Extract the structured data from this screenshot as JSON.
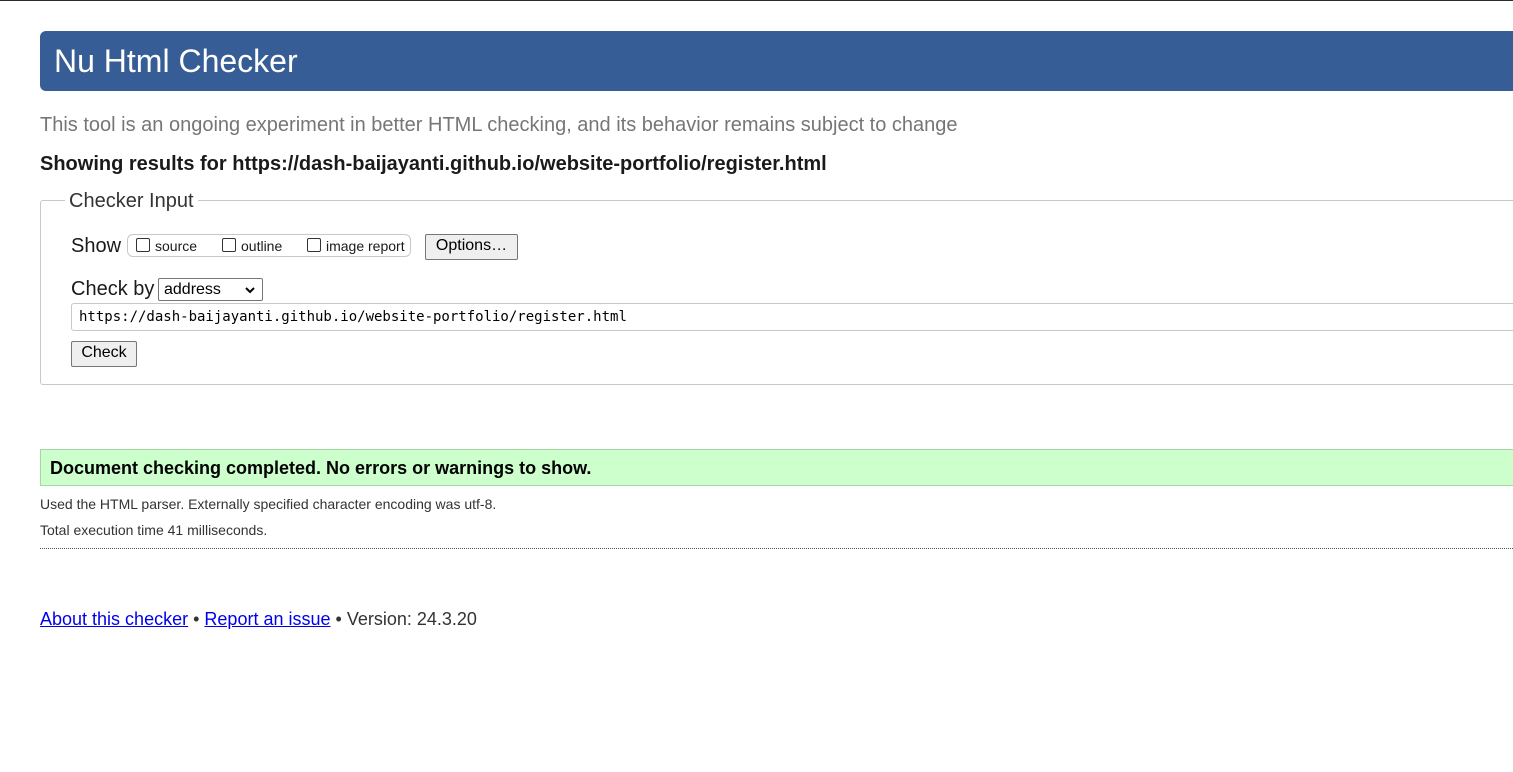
{
  "header": {
    "title": "Nu Html Checker"
  },
  "intro": "This tool is an ongoing experiment in better HTML checking, and its behavior remains subject to change",
  "results_for": "Showing results for https://dash-baijayanti.github.io/website-portfolio/register.html",
  "checker_input": {
    "legend": "Checker Input",
    "show_label": "Show",
    "show_options": [
      {
        "label": "source",
        "checked": false
      },
      {
        "label": "outline",
        "checked": false
      },
      {
        "label": "image report",
        "checked": false
      }
    ],
    "options_button": "Options…",
    "check_by_label": "Check by",
    "check_by_selected": "address",
    "url_value": "https://dash-baijayanti.github.io/website-portfolio/register.html",
    "check_button": "Check"
  },
  "result": {
    "message": "Document checking completed. No errors or warnings to show.",
    "color": "#ccffcc"
  },
  "details": {
    "parser": "Used the HTML parser. Externally specified character encoding was utf-8.",
    "time": "Total execution time 41 milliseconds."
  },
  "footer": {
    "about_link": "About this checker",
    "separator": "•",
    "report_link": "Report an issue",
    "version": "Version: 24.3.20"
  },
  "colors": {
    "header_bg": "#365d95",
    "link": "#0000ee"
  }
}
